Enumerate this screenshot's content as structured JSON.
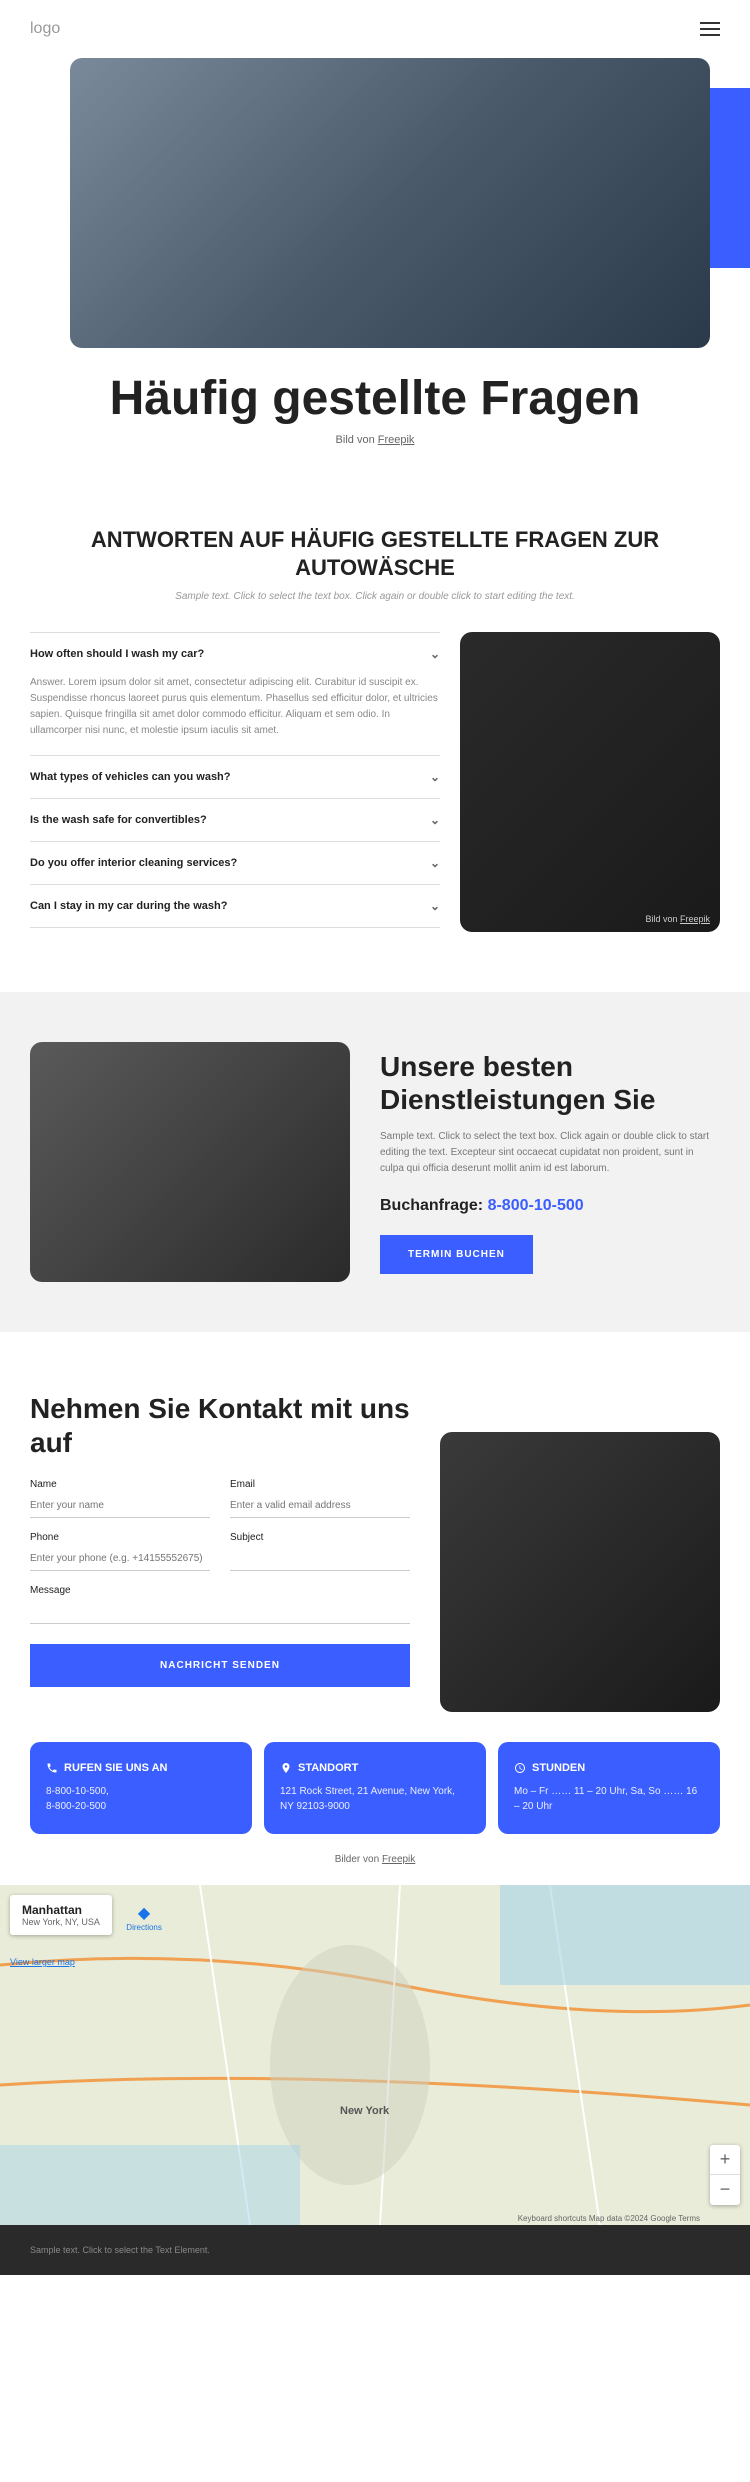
{
  "header": {
    "logo": "logo"
  },
  "hero": {
    "title": "Häufig gestellte Fragen",
    "credit_prefix": "Bild von ",
    "credit_link": "Freepik"
  },
  "faq_section": {
    "title": "ANTWORTEN AUF HÄUFIG GESTELLTE FRAGEN ZUR AUTOWÄSCHE",
    "subtitle": "Sample text. Click to select the text box. Click again or double click to start editing the text.",
    "items": [
      {
        "q": "How often should I wash my car?",
        "a": "Answer. Lorem ipsum dolor sit amet, consectetur adipiscing elit. Curabitur id suscipit ex. Suspendisse rhoncus laoreet purus quis elementum. Phasellus sed efficitur dolor, et ultricies sapien. Quisque fringilla sit amet dolor commodo efficitur. Aliquam et sem odio. In ullamcorper nisi nunc, et molestie ipsum iaculis sit amet."
      },
      {
        "q": "What types of vehicles can you wash?",
        "a": ""
      },
      {
        "q": "Is the wash safe for convertibles?",
        "a": ""
      },
      {
        "q": "Do you offer interior cleaning services?",
        "a": ""
      },
      {
        "q": "Can I stay in my car during the wash?",
        "a": ""
      }
    ],
    "img_credit_prefix": "Bild von ",
    "img_credit_link": "Freepik"
  },
  "services": {
    "title": "Unsere besten Dienstleistungen Sie",
    "text": "Sample text. Click to select the text box. Click again or double click to start editing the text. Excepteur sint occaecat cupidatat non proident, sunt in culpa qui officia deserunt mollit anim id est laborum.",
    "phone_label": "Buchanfrage: ",
    "phone": "8-800-10-500",
    "button": "TERMIN BUCHEN"
  },
  "contact": {
    "title": "Nehmen Sie Kontakt mit uns auf",
    "fields": {
      "name_label": "Name",
      "name_placeholder": "Enter your name",
      "email_label": "Email",
      "email_placeholder": "Enter a valid email address",
      "phone_label": "Phone",
      "phone_placeholder": "Enter your phone (e.g. +14155552675)",
      "subject_label": "Subject",
      "subject_placeholder": "",
      "message_label": "Message"
    },
    "submit": "NACHRICHT SENDEN"
  },
  "info_cards": [
    {
      "icon": "phone",
      "title": "RUFEN SIE UNS AN",
      "text": "8-800-10-500,\n8-800-20-500"
    },
    {
      "icon": "pin",
      "title": "STANDORT",
      "text": "121 Rock Street, 21 Avenue, New York, NY 92103-9000"
    },
    {
      "icon": "clock",
      "title": "STUNDEN",
      "text": "Mo – Fr …… 11 – 20 Uhr, Sa, So …… 16 – 20 Uhr"
    }
  ],
  "credit_bottom": {
    "prefix": "Bilder von ",
    "link": "Freepik"
  },
  "map": {
    "panel_title": "Manhattan",
    "panel_sub": "New York, NY, USA",
    "directions": "Directions",
    "larger": "View larger map",
    "label_nyc": "New York",
    "attribution": "Keyboard shortcuts   Map data ©2024 Google   Terms"
  },
  "footer": {
    "text": "Sample text. Click to select the Text Element."
  }
}
